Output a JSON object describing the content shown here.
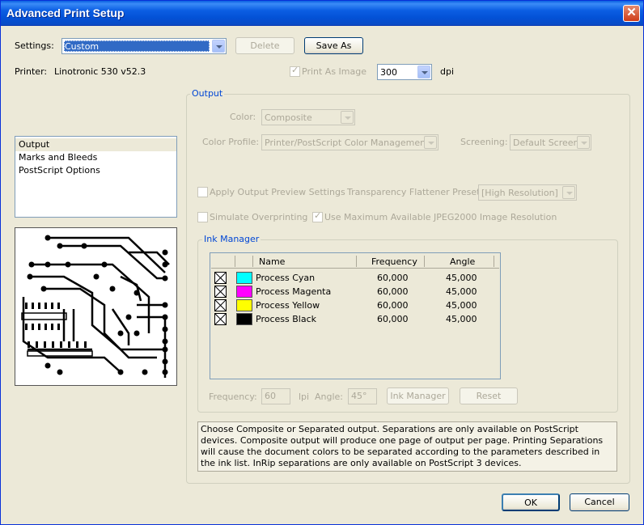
{
  "window": {
    "title": "Advanced Print Setup",
    "close_glyph": "✕"
  },
  "settings": {
    "label": "Settings:",
    "value": "Custom",
    "delete_label": "Delete",
    "save_as_label": "Save As"
  },
  "printer": {
    "label": "Printer:",
    "value": "Linotronic 530 v52.3",
    "print_as_image_label": "Print As Image",
    "print_as_image_checked": true,
    "dpi_value": "300",
    "dpi_label": "dpi"
  },
  "sidebar": {
    "items": [
      {
        "label": "Output",
        "selected": true
      },
      {
        "label": "Marks and Bleeds",
        "selected": false
      },
      {
        "label": "PostScript Options",
        "selected": false
      }
    ]
  },
  "output": {
    "group_title": "Output",
    "color_label": "Color:",
    "color_value": "Composite",
    "color_profile_label": "Color Profile:",
    "color_profile_value": "Printer/PostScript Color Management",
    "screening_label": "Screening:",
    "screening_value": "Default Screen",
    "apply_preview_label": "Apply Output Preview Settings",
    "apply_preview_checked": false,
    "flattener_label": "Transparency Flattener Preset:",
    "flattener_value": "[High Resolution]",
    "simulate_overprint_label": "Simulate Overprinting",
    "simulate_overprint_checked": false,
    "jpeg2000_label": "Use Maximum Available JPEG2000 Image Resolution",
    "jpeg2000_checked": true
  },
  "ink_manager": {
    "group_title": "Ink Manager",
    "columns": {
      "name": "Name",
      "frequency": "Frequency",
      "angle": "Angle"
    },
    "inks": [
      {
        "name": "Process Cyan",
        "frequency": "60,000",
        "angle": "45,000",
        "color": "#00ffff"
      },
      {
        "name": "Process Magenta",
        "frequency": "60,000",
        "angle": "45,000",
        "color": "#ff00ff"
      },
      {
        "name": "Process Yellow",
        "frequency": "60,000",
        "angle": "45,000",
        "color": "#ffff00"
      },
      {
        "name": "Process Black",
        "frequency": "60,000",
        "angle": "45,000",
        "color": "#000000"
      }
    ],
    "frequency_label": "Frequency:",
    "frequency_value": "60",
    "lpi_label": "lpi",
    "angle_label": "Angle:",
    "angle_value": "45°",
    "ink_manager_button": "Ink Manager",
    "reset_button": "Reset"
  },
  "info_text": "Choose Composite or Separated output. Separations are only available on PostScript devices. Composite output will produce one page of output per page. Printing Separations will cause the document colors to be separated according to the parameters described in the ink list. InRip separations are only available on PostScript 3 devices.",
  "footer": {
    "ok_label": "OK",
    "cancel_label": "Cancel"
  }
}
